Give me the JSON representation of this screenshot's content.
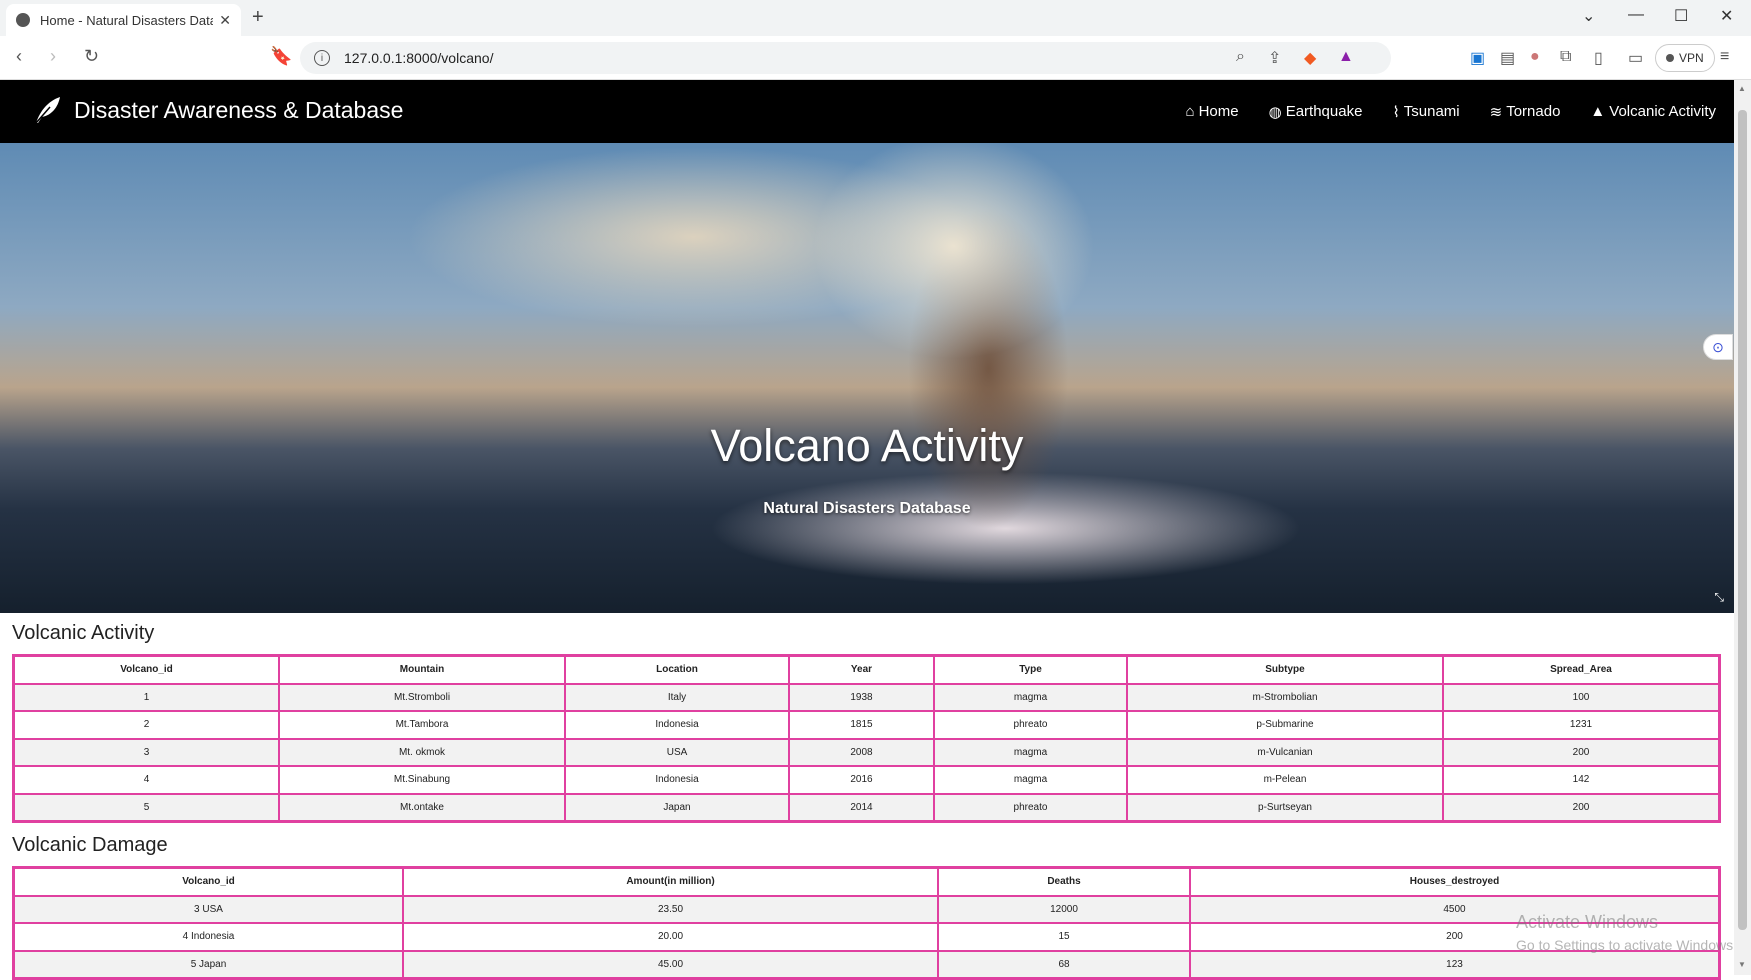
{
  "browser": {
    "tab_title": "Home - Natural Disasters Datab",
    "url": "127.0.0.1:8000/volcano/",
    "vpn_label": "VPN"
  },
  "site": {
    "brand": "Disaster Awareness & Database",
    "nav": [
      {
        "label": "Home",
        "icon": "home-icon"
      },
      {
        "label": "Earthquake",
        "icon": "globe-icon"
      },
      {
        "label": "Tsunami",
        "icon": "pulse-icon"
      },
      {
        "label": "Tornado",
        "icon": "wind-icon"
      },
      {
        "label": "Volcanic Activity",
        "icon": "mountain-icon"
      }
    ]
  },
  "hero": {
    "title": "Volcano Activity",
    "subtitle": "Natural Disasters Database"
  },
  "activity": {
    "title": "Volcanic Activity",
    "columns": [
      "Volcano_id",
      "Mountain",
      "Location",
      "Year",
      "Type",
      "Subtype",
      "Spread_Area"
    ],
    "rows": [
      [
        "1",
        "Mt.Stromboli",
        "Italy",
        "1938",
        "magma",
        "m-Strombolian",
        "100"
      ],
      [
        "2",
        "Mt.Tambora",
        "Indonesia",
        "1815",
        "phreato",
        "p-Submarine",
        "1231"
      ],
      [
        "3",
        "Mt. okmok",
        "USA",
        "2008",
        "magma",
        "m-Vulcanian",
        "200"
      ],
      [
        "4",
        "Mt.Sinabung",
        "Indonesia",
        "2016",
        "magma",
        "m-Pelean",
        "142"
      ],
      [
        "5",
        "Mt.ontake",
        "Japan",
        "2014",
        "phreato",
        "p-Surtseyan",
        "200"
      ]
    ]
  },
  "damage": {
    "title": "Volcanic Damage",
    "columns": [
      "Volcano_id",
      "Amount(in million)",
      "Deaths",
      "Houses_destroyed"
    ],
    "rows": [
      [
        "3 USA",
        "23.50",
        "12000",
        "4500"
      ],
      [
        "4 Indonesia",
        "20.00",
        "15",
        "200"
      ],
      [
        "5 Japan",
        "45.00",
        "68",
        "123"
      ]
    ]
  },
  "watermark": {
    "line1": "Activate Windows",
    "line2": "Go to Settings to activate Windows."
  },
  "colors": {
    "table_border": "#e040a0",
    "navbar_bg": "#000000"
  }
}
